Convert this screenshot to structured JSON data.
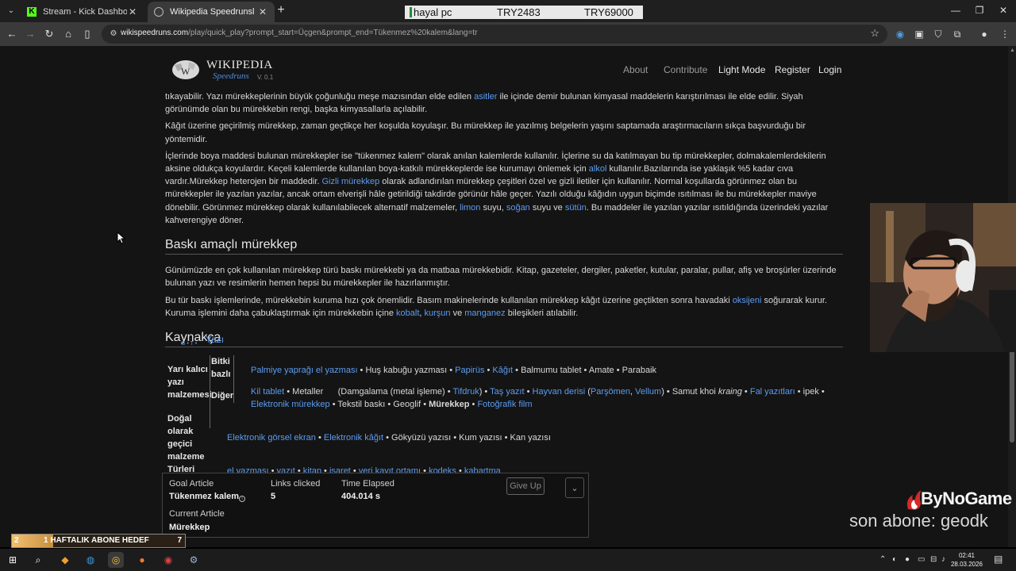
{
  "browser": {
    "tabs": [
      {
        "title": "Stream - Kick Dashboard",
        "favicon": "kick-icon",
        "active": false
      },
      {
        "title": "Wikipedia Speedrunsl",
        "favicon": "globe-icon",
        "active": true
      }
    ],
    "url_domain": "wikispeedruns.com",
    "url_path": "/play/quick_play?prompt_start=Üçgen&prompt_end=Tükenmez%20kalem&lang=tr",
    "new_tab": "+",
    "win_minimize": "—",
    "win_restore": "❐",
    "win_close": "✕"
  },
  "stream_bar": {
    "name": "hayal pc",
    "value1": "TRY2483",
    "value2": "TRY69000"
  },
  "site": {
    "logo_title": "WIKIPEDIA",
    "logo_subtitle": "Speedruns",
    "version": "V. 0.1",
    "nav": [
      "About",
      "Contribute",
      "Light Mode",
      "Register",
      "Login"
    ]
  },
  "article": {
    "p1": {
      "a": "tıkayabilir. Yazı mürekkeplerinin büyük çoğunluğu meşe mazısından elde edilen ",
      "link": "asitler",
      "b": " ile içinde demir bulunan kimyasal maddelerin karıştırılması ile elde edilir. Siyah görünümde olan bu mürekkebin rengi, başka kimyasallarla açılabilir."
    },
    "p2": "Kâğıt üzerine geçirilmiş mürekkep, zaman geçtikçe her koşulda koyulaşır. Bu mürekkep ile yazılmış belgelerin yaşını saptamada araştırmacıların sıkça başvurduğu bir yöntemidir.",
    "p3": {
      "a": "İçlerinde boya maddesi bulunan mürekkepler ise \"tükenmez kalem\" olarak anılan kalemlerde kullanılır. İçlerine su da katılmayan bu tip mürekkepler, dolmakalemlerdekilerin aksine oldukça koyulardır. Keçeli kalemlerde kullanılan boya-katkılı mürekkeplerde ise kurumayı önlemek için ",
      "link1": "alkol",
      "b": " kullanılır.Bazılarında ise yaklaşık %5 kadar cıva vardır.Mürekkep heterojen bir maddedir. ",
      "link2": "Gizli mürekkep",
      "c": " olarak adlandırılan mürekkep çeşitleri özel ve gizli iletiler için kullanılır. Normal koşullarda görünmez olan bu mürekkepler ile yazılan yazılar, ancak ortam elverişli hâle getirildiği takdirde görünür hâle geçer. Yazılı olduğu kâğıdın uygun biçimde ısıtılması ile bu mürekkepler maviye dönebilir. Görünmez mürekkep olarak kullanılabilecek alternatif malzemeler, ",
      "link3": "limon",
      "d": " suyu, ",
      "link4": "soğan",
      "e": " suyu ve ",
      "link5": "sütün",
      "f": ". Bu maddeler ile yazılan yazılar ısıtıldığında üzerindeki yazılar kahverengiye döner."
    },
    "h_baski": "Baskı amaçlı mürekkep",
    "p4": "Günümüzde en çok kullanılan mürekkep türü baskı mürekkebi ya da matbaa mürekkebidir. Kitap, gazeteler, dergiler, paketler, kutular, paralar, pullar, afiş ve broşürler üzerinde bulunan yazı ve resimlerin hemen hepsi bu mürekkepler ile hazırlanmıştır.",
    "p5": {
      "a": "Bu tür baskı işlemlerinde, mürekkebin kuruma hızı çok önemlidir. Basım makinelerinde kullanılan mürekkep kâğıt üzerine geçtikten sonra havadaki ",
      "link1": "oksijeni",
      "b": " soğurarak kurur. Kuruma işlemini daha çabuklaştırmak için mürekkebin içine ",
      "link2": "kobalt",
      "c": ", ",
      "link3": "kurşun",
      "d": " ve ",
      "link4": "manganez",
      "e": " bileşikleri atılabilir."
    },
    "h_kaynak": "Kaynakça"
  },
  "navbox": {
    "vte": "G • T •",
    "title": "Yazı",
    "group1": "Yarı kalıcı yazı malzemesi",
    "sub1": "Bitki bazlı",
    "sub2": "Diğer",
    "row1": [
      {
        "t": "Palmiye yaprağı el yazması",
        "l": true
      },
      {
        "t": " • Huş kabuğu yazması • ",
        "l": false
      },
      {
        "t": "Papirüs",
        "l": true
      },
      {
        "t": " • ",
        "l": false
      },
      {
        "t": "Kâğıt",
        "l": true
      },
      {
        "t": " • Balmumu tablet • Amate • Parabaik",
        "l": false
      }
    ],
    "row2": [
      {
        "t": "Kil tablet",
        "l": true
      },
      {
        "t": " • Metaller      (Damgalama (metal işleme) • ",
        "l": false
      },
      {
        "t": "Tifdruk",
        "l": true
      },
      {
        "t": ") • ",
        "l": false
      },
      {
        "t": "Taş yazıt",
        "l": true
      },
      {
        "t": " • ",
        "l": false
      },
      {
        "t": "Hayvan derisi",
        "l": true
      },
      {
        "t": " (",
        "l": false
      },
      {
        "t": "Parşömen",
        "l": true
      },
      {
        "t": ", ",
        "l": false
      },
      {
        "t": "Vellum",
        "l": true
      },
      {
        "t": ") • Samut khoi ",
        "l": false
      },
      {
        "t": "kraing",
        "l": false,
        "i": true
      },
      {
        "t": " • ",
        "l": false
      },
      {
        "t": "Fal yazıtları",
        "l": true
      },
      {
        "t": " • ipek •",
        "l": false
      }
    ],
    "row3": [
      {
        "t": "Elektronik mürekkep",
        "l": true
      },
      {
        "t": " • Tekstil baskı • Geoglif • ",
        "l": false
      },
      {
        "t": "Mürekkep",
        "l": false,
        "b": true
      },
      {
        "t": " • ",
        "l": false
      },
      {
        "t": "Fotoğrafik film",
        "l": true
      }
    ],
    "group2": "Doğal olarak geçici malzeme",
    "row4": [
      {
        "t": "Elektronik görsel ekran",
        "l": true
      },
      {
        "t": " • ",
        "l": false
      },
      {
        "t": "Elektronik kâğıt",
        "l": true
      },
      {
        "t": " • Gökyüzü yazısı • Kum yazısı • Kan yazısı",
        "l": false
      }
    ],
    "group3": "Türleri",
    "row5": [
      {
        "t": "el yazması",
        "l": true
      },
      {
        "t": " • ",
        "l": false
      },
      {
        "t": "yazıt",
        "l": true
      },
      {
        "t": " • ",
        "l": false
      },
      {
        "t": "kitap",
        "l": true
      },
      {
        "t": " • ",
        "l": false
      },
      {
        "t": "işaret",
        "l": true
      },
      {
        "t": " • ",
        "l": false
      },
      {
        "t": "veri kayıt ortamı",
        "l": true
      },
      {
        "t": " • ",
        "l": false
      },
      {
        "t": "kodeks",
        "l": true
      },
      {
        "t": " • ",
        "l": false
      },
      {
        "t": "kabartma",
        "l": true
      }
    ]
  },
  "speedrun": {
    "goal_label": "Goal Article",
    "goal_value": "Tükenmez kalem",
    "links_label": "Links clicked",
    "links_value": "5",
    "time_label": "Time Elapsed",
    "time_value": "404.014 s",
    "current_label": "Current Article",
    "current_value": "Mürekkep",
    "give_up": "Give Up",
    "expand": "⌄"
  },
  "overlay": {
    "brand": "ByNoGame",
    "last_sub": "son abone: geodk",
    "goal_left": "2",
    "goal_text": "1 HAFTALIK ABONE HEDEF",
    "goal_right": "7",
    "goal_progress": 0.24
  },
  "taskbar": {
    "time": "02:41",
    "date": "28.03.2026"
  }
}
